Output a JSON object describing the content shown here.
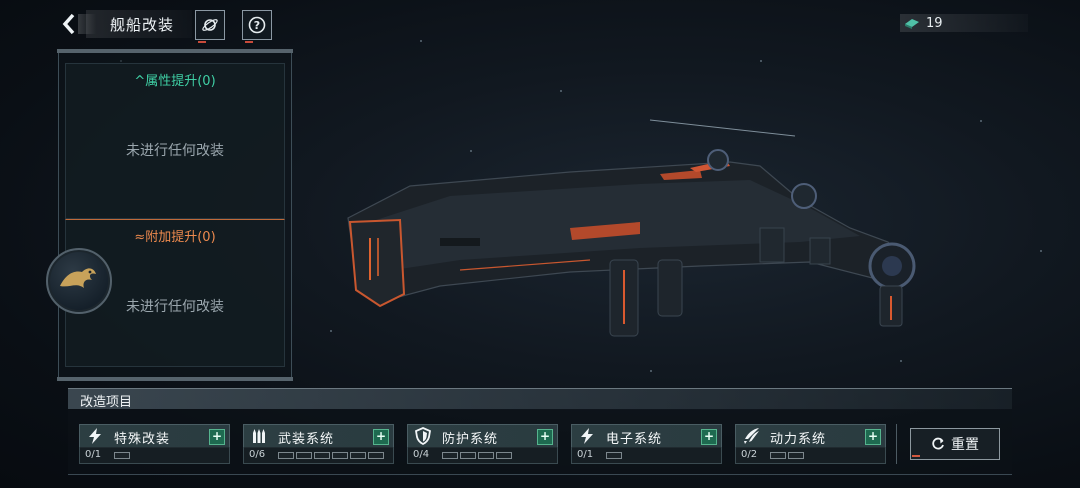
{
  "header": {
    "title": "舰船改装",
    "back_icon": "chevron-left-icon",
    "planet_icon": "planet-icon",
    "help_icon": "question-icon",
    "currency": {
      "icon": "chip-icon",
      "value": "19"
    }
  },
  "info_panel": {
    "attribute": {
      "title": "属性提升(0)",
      "empty": "未进行任何改装"
    },
    "bonus": {
      "title": "附加提升(0)",
      "empty": "未进行任何改装"
    }
  },
  "modification": {
    "section_title": "改造项目",
    "items": [
      {
        "label": "特殊改装",
        "icon": "lightning-icon",
        "count": "0/1",
        "slots": 1
      },
      {
        "label": "武装系统",
        "icon": "ammo-icon",
        "count": "0/6",
        "slots": 6
      },
      {
        "label": "防护系统",
        "icon": "shield-icon",
        "count": "0/4",
        "slots": 4
      },
      {
        "label": "电子系统",
        "icon": "lightning-icon",
        "count": "0/1",
        "slots": 1
      },
      {
        "label": "动力系统",
        "icon": "thruster-icon",
        "count": "0/2",
        "slots": 2
      }
    ],
    "plus_symbol": "+",
    "reset_label": "重置"
  },
  "colors": {
    "accent_green": "#3fd0a5",
    "accent_orange": "#ee8a4e",
    "plus_bg": "#1e6a50"
  }
}
